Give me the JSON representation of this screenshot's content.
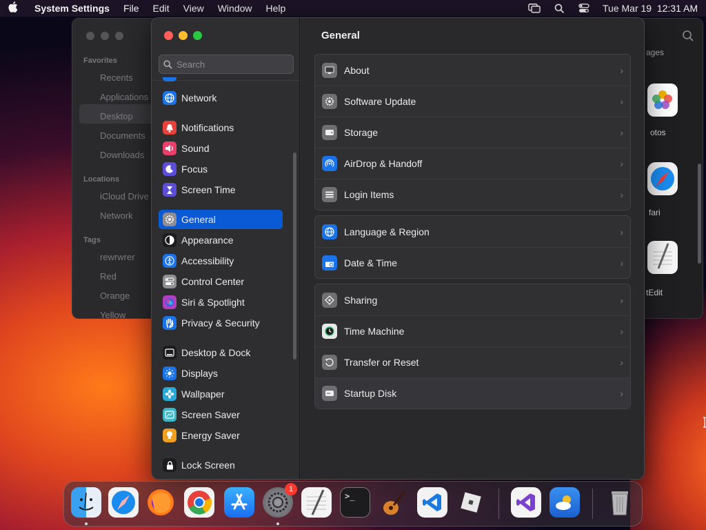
{
  "menubar": {
    "app_name": "System Settings",
    "menus": [
      "File",
      "Edit",
      "View",
      "Window",
      "Help"
    ],
    "datetime": "Tue Mar 19  12:31 AM"
  },
  "finder": {
    "favorites_header": "Favorites",
    "favorites": [
      "Recents",
      "Applications",
      "Desktop",
      "Documents",
      "Downloads"
    ],
    "locations_header": "Locations",
    "locations": [
      "iCloud Drive",
      "Network"
    ],
    "tags_header": "Tags",
    "tags": [
      "rewrwrer",
      "Red",
      "Orange",
      "Yellow"
    ],
    "apps": [
      "otos",
      "fari",
      "tEdit"
    ],
    "top_partial": "ages"
  },
  "settings": {
    "search_placeholder": "Search",
    "sidebar": [
      {
        "label": "Network",
        "icon": "globe-icon",
        "color": "#1a73e8"
      },
      {
        "label": "Notifications",
        "icon": "bell-icon",
        "color": "#e8403a"
      },
      {
        "label": "Sound",
        "icon": "speaker-icon",
        "color": "#e8406a"
      },
      {
        "label": "Focus",
        "icon": "moon-icon",
        "color": "#5c4ed8"
      },
      {
        "label": "Screen Time",
        "icon": "hourglass-icon",
        "color": "#5c4ed8"
      },
      {
        "label": "General",
        "icon": "gear-icon",
        "color": "#8e8e93"
      },
      {
        "label": "Appearance",
        "icon": "circle-half-icon",
        "color": "#1c1c1e"
      },
      {
        "label": "Accessibility",
        "icon": "accessibility-icon",
        "color": "#1a73e8"
      },
      {
        "label": "Control Center",
        "icon": "toggles-icon",
        "color": "#8e8e93"
      },
      {
        "label": "Siri & Spotlight",
        "icon": "siri-icon",
        "color": "#b040c0"
      },
      {
        "label": "Privacy & Security",
        "icon": "hand-icon",
        "color": "#1a73e8"
      },
      {
        "label": "Desktop & Dock",
        "icon": "dock-icon",
        "color": "#1c1c1e"
      },
      {
        "label": "Displays",
        "icon": "sun-icon",
        "color": "#1a73e8"
      },
      {
        "label": "Wallpaper",
        "icon": "flower-icon",
        "color": "#2aa8d8"
      },
      {
        "label": "Screen Saver",
        "icon": "screensaver-icon",
        "color": "#3ab8c8"
      },
      {
        "label": "Energy Saver",
        "icon": "bulb-icon",
        "color": "#f0a020"
      },
      {
        "label": "Lock Screen",
        "icon": "lock-icon",
        "color": "#1c1c1e"
      }
    ],
    "selected": "General",
    "title": "General",
    "groups": [
      [
        {
          "label": "About",
          "icon": "computer-icon"
        },
        {
          "label": "Software Update",
          "icon": "gear-badge-icon"
        },
        {
          "label": "Storage",
          "icon": "drive-icon"
        },
        {
          "label": "AirDrop & Handoff",
          "icon": "airdrop-icon"
        },
        {
          "label": "Login Items",
          "icon": "list-icon"
        }
      ],
      [
        {
          "label": "Language & Region",
          "icon": "globe-icon"
        },
        {
          "label": "Date & Time",
          "icon": "calendar-icon"
        }
      ],
      [
        {
          "label": "Sharing",
          "icon": "sharing-icon"
        },
        {
          "label": "Time Machine",
          "icon": "clock-icon"
        },
        {
          "label": "Transfer or Reset",
          "icon": "reset-icon"
        },
        {
          "label": "Startup Disk",
          "icon": "disk-icon"
        }
      ]
    ],
    "chevron": "›"
  },
  "dock": {
    "settings_badge": "1",
    "terminal_prompt": ">_"
  }
}
